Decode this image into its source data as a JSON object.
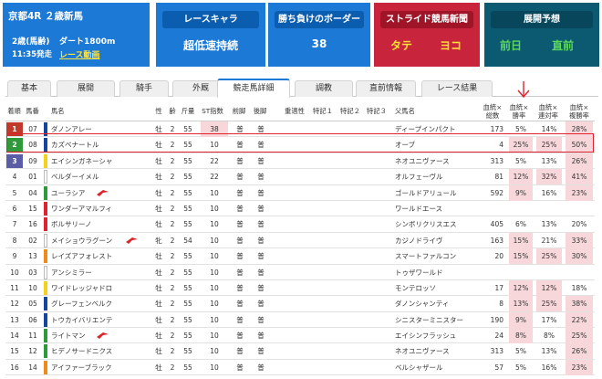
{
  "race": {
    "title": "京都4R ２歳新馬",
    "class": "2歳(馬齢)",
    "course": "ダート1800m",
    "start": "11:35発走",
    "video_link": "レース動画"
  },
  "cards": {
    "character": {
      "label": "レースキャラ",
      "value": "超低速持続"
    },
    "border": {
      "label": "勝ち負けのボーダー",
      "value": "38"
    },
    "stride": {
      "label": "ストライド競馬新聞",
      "left": "タテ",
      "right": "ヨコ"
    },
    "forecast": {
      "label": "展開予想",
      "left": "前日",
      "right": "直前"
    }
  },
  "colors": {
    "card_blue": "#1c7ad6",
    "card_red": "#c8243b",
    "card_teal": "#0c5a72",
    "highlight": "#f7d7da",
    "selection": "#e0222e",
    "yellow": "#ffe23c",
    "green": "#5bd75b"
  },
  "tabs": [
    "基本",
    "展開",
    "騎手",
    "外厩",
    "競走馬詳細",
    "調教",
    "直前情報",
    "レース結果"
  ],
  "active_tab": "競走馬詳細",
  "table": {
    "headers": {
      "waku": "着順",
      "umaban": "馬番",
      "name": "馬名",
      "sex": "性",
      "age": "齢",
      "weight": "斤量",
      "st": "ST指数",
      "front": "前脚",
      "back": "後脚",
      "heavy": "重適性",
      "note1": "特記１",
      "note2": "特記２",
      "note3": "特記３",
      "sire": "父馬名",
      "starts": "血統×\n総数",
      "win": "血統×\n勝率",
      "place": "血統×\n連対率",
      "show": "血統×\n複勝率"
    },
    "rows": [
      {
        "waku": "1",
        "waku_color": "#c0392b",
        "umaban": "07",
        "bar": "#1446a0",
        "name": "ダノンアレー",
        "mark": "",
        "sex": "牡",
        "age": "2",
        "weight": "55",
        "st": "38",
        "front": "普",
        "back": "普",
        "sire": "ディープインパクト",
        "starts": "173",
        "win": "5%",
        "place": "14%",
        "show": "28%",
        "hl": [
          "st",
          "show"
        ]
      },
      {
        "waku": "2",
        "waku_color": "#2e9a3a",
        "umaban": "08",
        "bar": "#1446a0",
        "name": "カズベナートル",
        "mark": "",
        "sex": "牡",
        "age": "2",
        "weight": "55",
        "st": "10",
        "front": "普",
        "back": "普",
        "sire": "オーブ",
        "starts": "4",
        "win": "25%",
        "place": "25%",
        "show": "50%",
        "hl": [
          "win",
          "place",
          "show"
        ]
      },
      {
        "waku": "3",
        "waku_color": "#5b5ea6",
        "umaban": "09",
        "bar": "#f2d31a",
        "name": "エイシンガネーシャ",
        "mark": "",
        "sex": "牡",
        "age": "2",
        "weight": "55",
        "st": "22",
        "front": "普",
        "back": "普",
        "sire": "ネオユニヴァース",
        "starts": "313",
        "win": "5%",
        "place": "13%",
        "show": "26%",
        "hl": [
          "show"
        ]
      },
      {
        "waku": "4",
        "waku_color": "#ffffff",
        "umaban": "01",
        "bar": "#ffffff",
        "name": "ベルダーイメル",
        "mark": "",
        "sex": "牡",
        "age": "2",
        "weight": "55",
        "st": "22",
        "front": "普",
        "back": "普",
        "sire": "オルフェーヴル",
        "starts": "81",
        "win": "12%",
        "place": "32%",
        "show": "41%",
        "hl": [
          "win",
          "place",
          "show"
        ]
      },
      {
        "waku": "5",
        "waku_color": "#ffffff",
        "umaban": "04",
        "bar": "#2e9a3a",
        "name": "ユーラシア",
        "mark": "red",
        "sex": "牡",
        "age": "2",
        "weight": "55",
        "st": "10",
        "front": "普",
        "back": "普",
        "sire": "ゴールドアリュール",
        "starts": "592",
        "win": "9%",
        "place": "16%",
        "show": "23%",
        "hl": [
          "win",
          "show"
        ]
      },
      {
        "waku": "6",
        "waku_color": "#ffffff",
        "umaban": "15",
        "bar": "#e0222e",
        "name": "ワンダーアマルフィ",
        "mark": "",
        "sex": "牡",
        "age": "2",
        "weight": "55",
        "st": "10",
        "front": "普",
        "back": "普",
        "sire": "ワールドエース",
        "starts": "",
        "win": "",
        "place": "",
        "show": "",
        "hl": []
      },
      {
        "waku": "7",
        "waku_color": "#ffffff",
        "umaban": "16",
        "bar": "#e0222e",
        "name": "ボルサリーノ",
        "mark": "",
        "sex": "牡",
        "age": "2",
        "weight": "55",
        "st": "10",
        "front": "普",
        "back": "普",
        "sire": "シンボリクリスエス",
        "starts": "405",
        "win": "6%",
        "place": "13%",
        "show": "20%",
        "hl": []
      },
      {
        "waku": "8",
        "waku_color": "#ffffff",
        "umaban": "02",
        "bar": "#ffffff",
        "name": "メイショウラグーン",
        "mark": "red",
        "sex": "牝",
        "age": "2",
        "weight": "54",
        "st": "10",
        "front": "普",
        "back": "普",
        "sire": "カジノドライヴ",
        "starts": "163",
        "win": "15%",
        "place": "21%",
        "show": "33%",
        "hl": [
          "win",
          "show"
        ]
      },
      {
        "waku": "9",
        "waku_color": "#ffffff",
        "umaban": "13",
        "bar": "#f08a1a",
        "name": "レイズアフォレスト",
        "mark": "",
        "sex": "牡",
        "age": "2",
        "weight": "55",
        "st": "10",
        "front": "普",
        "back": "普",
        "sire": "スマートファルコン",
        "starts": "20",
        "win": "15%",
        "place": "25%",
        "show": "30%",
        "hl": [
          "win",
          "place",
          "show"
        ]
      },
      {
        "waku": "10",
        "waku_color": "#ffffff",
        "umaban": "03",
        "bar": "#ffffff",
        "name": "アンシミラー",
        "mark": "",
        "sex": "牡",
        "age": "2",
        "weight": "55",
        "st": "10",
        "front": "普",
        "back": "普",
        "sire": "トゥザワールド",
        "starts": "",
        "win": "",
        "place": "",
        "show": "",
        "hl": []
      },
      {
        "waku": "11",
        "waku_color": "#ffffff",
        "umaban": "10",
        "bar": "#f2d31a",
        "name": "ワイドレッジャドロ",
        "mark": "",
        "sex": "牡",
        "age": "2",
        "weight": "55",
        "st": "10",
        "front": "普",
        "back": "普",
        "sire": "モンテロッソ",
        "starts": "17",
        "win": "12%",
        "place": "12%",
        "show": "18%",
        "hl": [
          "win",
          "place"
        ]
      },
      {
        "waku": "12",
        "waku_color": "#ffffff",
        "umaban": "05",
        "bar": "#1446a0",
        "name": "グレーフェンベルク",
        "mark": "",
        "sex": "牡",
        "age": "2",
        "weight": "55",
        "st": "10",
        "front": "普",
        "back": "普",
        "sire": "ダノンシャンティ",
        "starts": "8",
        "win": "13%",
        "place": "25%",
        "show": "38%",
        "hl": [
          "win",
          "place",
          "show"
        ]
      },
      {
        "waku": "13",
        "waku_color": "#ffffff",
        "umaban": "06",
        "bar": "#1446a0",
        "name": "トウカイバリエンテ",
        "mark": "",
        "sex": "牡",
        "age": "2",
        "weight": "55",
        "st": "10",
        "front": "普",
        "back": "普",
        "sire": "シニスターミニスター",
        "starts": "190",
        "win": "9%",
        "place": "17%",
        "show": "22%",
        "hl": [
          "win",
          "show"
        ]
      },
      {
        "waku": "14",
        "waku_color": "#ffffff",
        "umaban": "11",
        "bar": "#2e9a3a",
        "name": "ライトマン",
        "mark": "red",
        "sex": "牡",
        "age": "2",
        "weight": "55",
        "st": "10",
        "front": "普",
        "back": "普",
        "sire": "エイシンフラッシュ",
        "starts": "24",
        "win": "8%",
        "place": "8%",
        "show": "25%",
        "hl": [
          "win",
          "show"
        ]
      },
      {
        "waku": "15",
        "waku_color": "#ffffff",
        "umaban": "12",
        "bar": "#2e9a3a",
        "name": "ヒデノサードニクス",
        "mark": "",
        "sex": "牡",
        "age": "2",
        "weight": "55",
        "st": "10",
        "front": "普",
        "back": "普",
        "sire": "ネオユニヴァース",
        "starts": "313",
        "win": "5%",
        "place": "13%",
        "show": "26%",
        "hl": [
          "show"
        ]
      },
      {
        "waku": "16",
        "waku_color": "#ffffff",
        "umaban": "14",
        "bar": "#f08a1a",
        "name": "アイファーブラック",
        "mark": "",
        "sex": "牡",
        "age": "2",
        "weight": "55",
        "st": "10",
        "front": "普",
        "back": "普",
        "sire": "ベルシャザール",
        "starts": "57",
        "win": "5%",
        "place": "16%",
        "show": "23%",
        "hl": [
          "show"
        ]
      }
    ]
  }
}
